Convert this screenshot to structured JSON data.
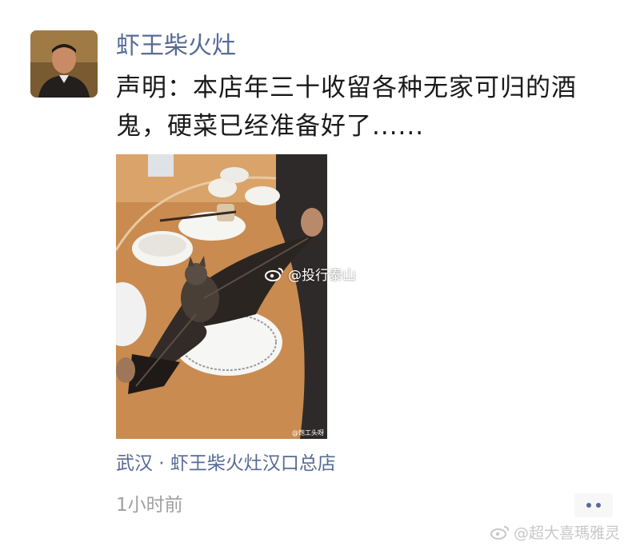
{
  "post": {
    "username": "虾王柴火灶",
    "text": "声明：本店年三十收留各种无家可归的酒鬼，硬菜已经准备好了......",
    "location": "武汉 · 虾王柴火灶汉口总店",
    "time": "1小时前"
  },
  "image": {
    "watermark_inline": "@投行泰山",
    "watermark_small": "@饱工头呀"
  },
  "watermark_bottom": "@超大喜瑪雅灵",
  "icons": {
    "avatar": "avatar-icon",
    "more": "ellipsis-icon",
    "weibo": "weibo-icon"
  },
  "colors": {
    "link": "#576b95",
    "text": "#1a1a1a",
    "muted": "#a0a0a0"
  }
}
